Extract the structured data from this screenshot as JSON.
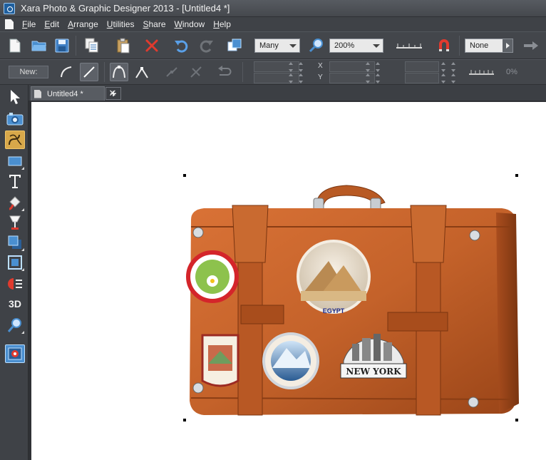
{
  "window": {
    "title": "Xara Photo & Graphic Designer 2013 - [Untitled4 *]"
  },
  "menu": [
    {
      "u": "F",
      "rest": "ile"
    },
    {
      "u": "E",
      "rest": "dit"
    },
    {
      "u": "A",
      "rest": "rrange"
    },
    {
      "u": "U",
      "rest": "tilities"
    },
    {
      "u": "S",
      "rest": "hare"
    },
    {
      "u": "W",
      "rest": "indow"
    },
    {
      "u": "H",
      "rest": "elp"
    }
  ],
  "toolbar": {
    "selection_combo": "Many",
    "zoom_combo": "200%",
    "feather_combo": "None"
  },
  "infobar": {
    "new_label": "New:",
    "x_label": "X",
    "y_label": "Y",
    "transparency_value": "0%"
  },
  "tabs": [
    {
      "label": "Untitled4 *"
    }
  ],
  "artwork": {
    "sticker_egypt": "EGYPT",
    "sticker_newyork": "NEW YORK"
  },
  "colors": {
    "chrome": "#43464b",
    "active_tool": "#d8a84a",
    "leather": "#c4622a"
  }
}
